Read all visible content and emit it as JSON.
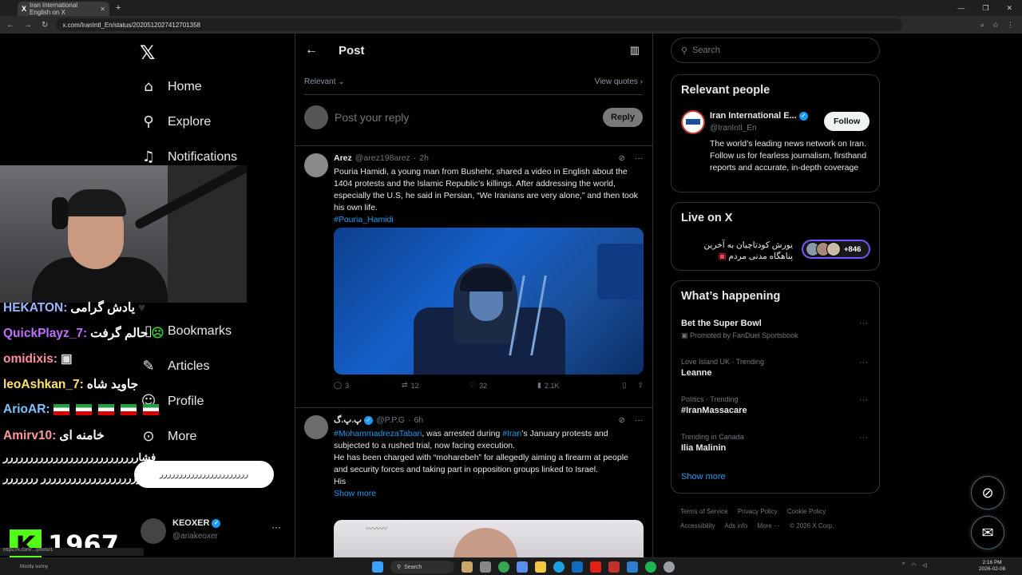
{
  "browser": {
    "tab_title": "Iran International English on X",
    "url": "x.com/IranIntl_En/status/2020512027412701358"
  },
  "sidebar": {
    "logo": "𝕏",
    "items": [
      {
        "label": "Home",
        "icon": "home-icon"
      },
      {
        "label": "Explore",
        "icon": "search-icon"
      },
      {
        "label": "Notifications",
        "icon": "bell-icon"
      },
      {
        "label": "Bookmarks",
        "icon": "bookmark-icon"
      },
      {
        "label": "Articles",
        "icon": "article-icon"
      },
      {
        "label": "Profile",
        "icon": "person-icon"
      },
      {
        "label": "More",
        "icon": "more-circle-icon"
      }
    ],
    "account": {
      "name": "KEOXER",
      "handle": "@ariakeoxer"
    }
  },
  "main": {
    "header_title": "Post",
    "sort_label": "Relevant",
    "view_quotes": "View quotes",
    "reply_placeholder": "Post your reply",
    "reply_button": "Reply",
    "tweets": [
      {
        "name": "Arez",
        "handle": "@arez198arez",
        "time": "2h",
        "text": "Pouria Hamidi, a young man from Bushehr, shared a video in English about the 1404 protests and the Islamic Republic’s killings. After addressing the world, especially the U.S, he said in Persian, “We Iranians are very alone,” and then took his own life.",
        "hashtag": "#Pouria_Hamidi",
        "replies": "3",
        "reposts": "12",
        "likes": "32",
        "views": "2.1K"
      },
      {
        "name": "پ.پ.گ",
        "handle": "@P.P.G",
        "time": "6h",
        "mention": "#MohammadrezaTabari",
        "text1": ", was arrested during ",
        "hashtag": "#Iran",
        "text2": "’s January protests and subjected to a rushed trial, now facing execution.",
        "text3": "He has been charged with “moharebeh” for allegedly aiming a firearm at people and security forces and taking part in opposition groups linked to Israel.",
        "text4": "His",
        "show_more": "Show more"
      }
    ]
  },
  "right": {
    "search_placeholder": "Search",
    "relevant_people": {
      "title": "Relevant people",
      "name": "Iran International E...",
      "handle": "@IranIntl_En",
      "follow": "Follow",
      "bio": "The world’s leading news network on Iran. Follow us for fearless journalism, firsthand reports and accurate, in-depth coverage"
    },
    "live": {
      "title": "Live on X",
      "text": "یورش کودتاچیان به آخرین پناهگاه مدنی مردم",
      "count": "+846"
    },
    "happening": {
      "title": "What’s happening",
      "trends": [
        {
          "context": "",
          "topic": "Bet the Super Bowl",
          "promo": "Promoted by FanDuel Sportsbook"
        },
        {
          "context": "Love Island UK · Trending",
          "topic": "Leanne"
        },
        {
          "context": "Politics · Trending",
          "topic": "#IranMassacare"
        },
        {
          "context": "Trending in Canada",
          "topic": "Ilia Malinin"
        }
      ],
      "show_more": "Show more"
    },
    "footer": [
      "Terms of Service",
      "Privacy Policy",
      "Cookie Policy",
      "Accessibility",
      "Ads info",
      "More ···",
      "© 2026 X Corp."
    ]
  },
  "overlay": {
    "chat": [
      {
        "user": "HEKATON:",
        "color": "#9ab8ff",
        "msg": "یادش گرامی"
      },
      {
        "user": "QuickPlayz_7:",
        "color": "#c070ff",
        "msg": "حالم گرفت"
      },
      {
        "user": "omidixis:",
        "color": "#ff8fa0",
        "msg": ""
      },
      {
        "user": "leoAshkan_7:",
        "color": "#ffe36b",
        "msg": "جاوید شاه"
      },
      {
        "user": "ArioAR:",
        "color": "#7fc3ff",
        "msg": ""
      },
      {
        "user": "Amirv10:",
        "color": "#ff9a9a",
        "msg": "خامنه ای"
      }
    ],
    "spam": "فشاررررررررررررررررررررررررررر رررررررررررررررررررررررررررررررر ررررررر",
    "bubble": "ررررررررررررررررررررررر",
    "viewer_count": "1967",
    "kick_logo": "K",
    "status_url": "https://x.com/.../photo/1",
    "weather": "Mostly sunny"
  },
  "taskbar": {
    "search": "Search",
    "time": "2:16 PM",
    "date": "2026-02-08"
  }
}
